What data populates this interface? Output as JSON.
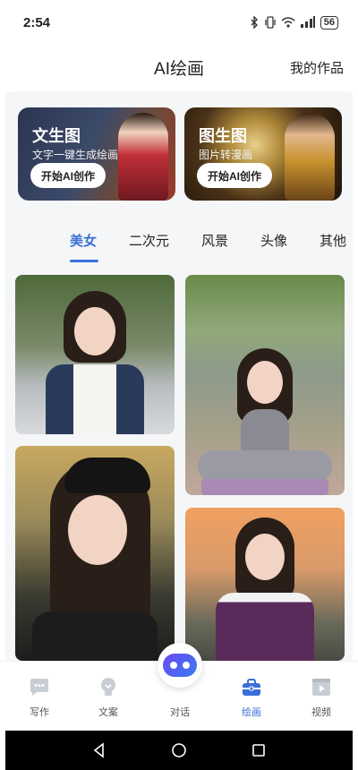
{
  "status_bar": {
    "time": "2:54",
    "battery": "56"
  },
  "header": {
    "title": "AI绘画",
    "my_works": "我的作品"
  },
  "banners": [
    {
      "title": "文生图",
      "subtitle": "文字一键生成绘画",
      "button": "开始AI创作"
    },
    {
      "title": "图生图",
      "subtitle": "图片转漫画",
      "button": "开始AI创作"
    }
  ],
  "tabs": [
    {
      "label": "美女",
      "active": true
    },
    {
      "label": "二次元",
      "active": false
    },
    {
      "label": "风景",
      "active": false
    },
    {
      "label": "头像",
      "active": false
    },
    {
      "label": "其他",
      "active": false
    }
  ],
  "nav": [
    {
      "label": "写作",
      "icon": "chat-icon"
    },
    {
      "label": "文案",
      "icon": "lightbulb-icon"
    },
    {
      "label": "对话",
      "icon": "bot-icon"
    },
    {
      "label": "绘画",
      "icon": "toolbox-icon",
      "active": true
    },
    {
      "label": "视频",
      "icon": "video-icon"
    }
  ],
  "colors": {
    "accent": "#3a6fd8",
    "background": "#f5f6f7"
  }
}
